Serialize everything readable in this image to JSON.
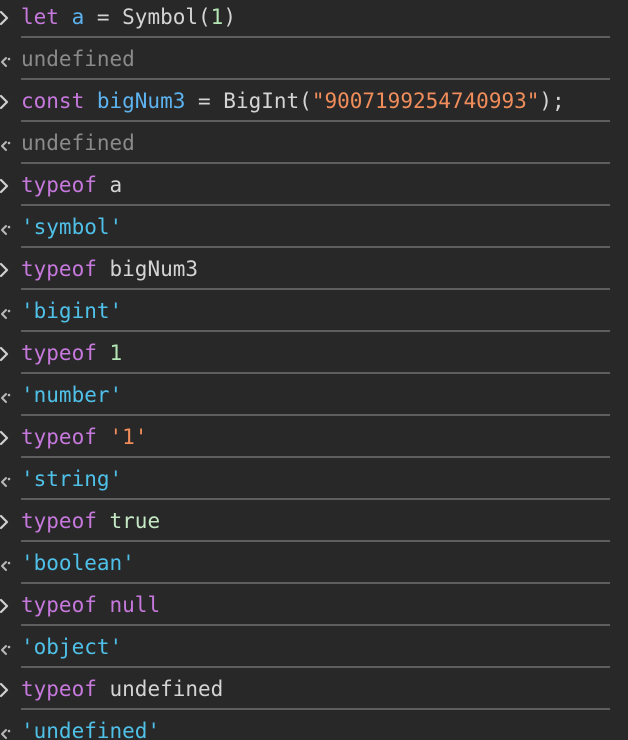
{
  "console": {
    "entries": [
      {
        "type": "input",
        "tokens": [
          [
            "kw",
            "let "
          ],
          [
            "var",
            "a"
          ],
          [
            "plain",
            " = Symbol("
          ],
          [
            "num",
            "1"
          ],
          [
            "plain",
            ")"
          ]
        ]
      },
      {
        "type": "output",
        "tokens": [
          [
            "undef",
            "undefined"
          ]
        ]
      },
      {
        "type": "input",
        "tokens": [
          [
            "kw",
            "const "
          ],
          [
            "var",
            "bigNum3"
          ],
          [
            "plain",
            " = BigInt("
          ],
          [
            "str",
            "\"9007199254740993\""
          ],
          [
            "plain",
            ");"
          ]
        ]
      },
      {
        "type": "output",
        "tokens": [
          [
            "undef",
            "undefined"
          ]
        ]
      },
      {
        "type": "input",
        "tokens": [
          [
            "kw",
            "typeof "
          ],
          [
            "plain",
            "a"
          ]
        ]
      },
      {
        "type": "output",
        "tokens": [
          [
            "res",
            "'symbol'"
          ]
        ]
      },
      {
        "type": "input",
        "tokens": [
          [
            "kw",
            "typeof "
          ],
          [
            "plain",
            "bigNum3"
          ]
        ]
      },
      {
        "type": "output",
        "tokens": [
          [
            "res",
            "'bigint'"
          ]
        ]
      },
      {
        "type": "input",
        "tokens": [
          [
            "kw",
            "typeof "
          ],
          [
            "num",
            "1"
          ]
        ]
      },
      {
        "type": "output",
        "tokens": [
          [
            "res",
            "'number'"
          ]
        ]
      },
      {
        "type": "input",
        "tokens": [
          [
            "kw",
            "typeof "
          ],
          [
            "str",
            "'1'"
          ]
        ]
      },
      {
        "type": "output",
        "tokens": [
          [
            "res",
            "'string'"
          ]
        ]
      },
      {
        "type": "input",
        "tokens": [
          [
            "kw",
            "typeof "
          ],
          [
            "lit",
            "true"
          ]
        ]
      },
      {
        "type": "output",
        "tokens": [
          [
            "res",
            "'boolean'"
          ]
        ]
      },
      {
        "type": "input",
        "tokens": [
          [
            "kw",
            "typeof "
          ],
          [
            "kw",
            "null"
          ]
        ]
      },
      {
        "type": "output",
        "tokens": [
          [
            "res",
            "'object'"
          ]
        ]
      },
      {
        "type": "input",
        "tokens": [
          [
            "kw",
            "typeof "
          ],
          [
            "plain",
            "undefined"
          ]
        ]
      },
      {
        "type": "output",
        "tokens": [
          [
            "res",
            "'undefined'"
          ]
        ]
      }
    ]
  },
  "icons": {
    "input_prompt": "chevron-right-icon",
    "output_prompt": "return-arrow-icon"
  },
  "colors": {
    "background": "#282828",
    "divider": "#5e5e5e",
    "keyword": "#c678dd",
    "variable": "#5cb3f0",
    "number": "#b5e6b5",
    "string": "#f08d5b",
    "result_string": "#4fc1e9",
    "undefined": "#8a8a8a"
  }
}
